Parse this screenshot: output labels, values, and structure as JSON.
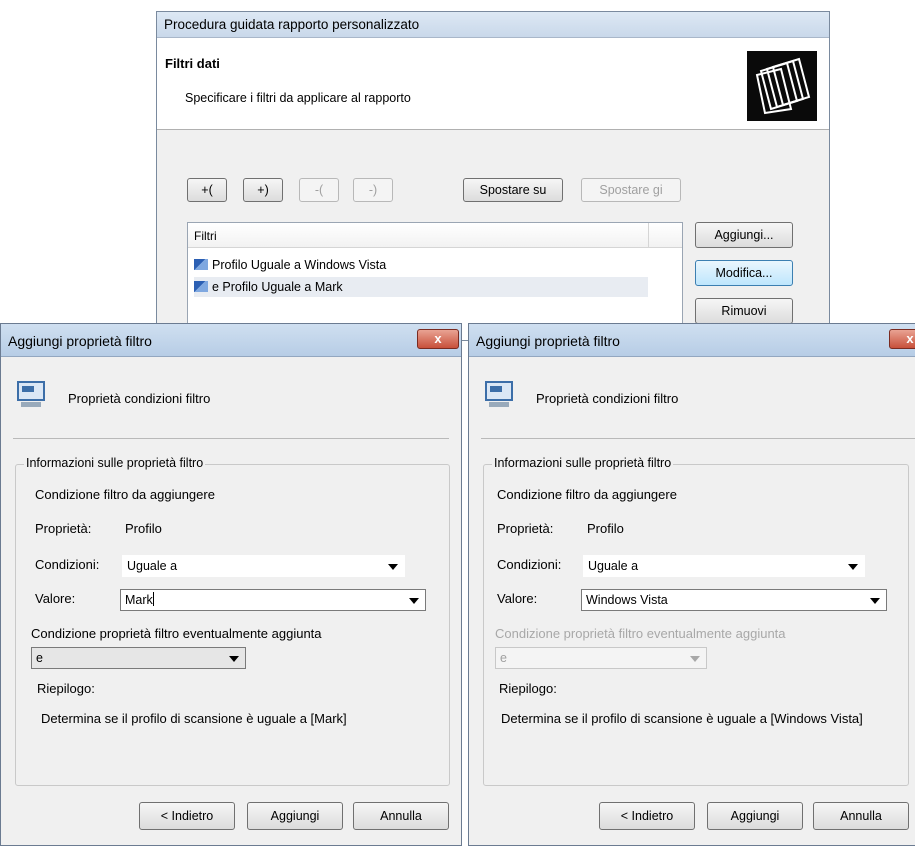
{
  "wizard": {
    "title": "Procedura guidata rapporto personalizzato",
    "header_title": "Filtri dati",
    "header_subtitle": "Specificare i filtri da applicare al rapporto",
    "paren_buttons": [
      "+(",
      "+)",
      "-(",
      "-)"
    ],
    "move_up": "Spostare su",
    "move_down": "Spostare gi",
    "list_header": "Filtri",
    "filters": [
      "Profilo Uguale a Windows Vista",
      "e Profilo Uguale a Mark"
    ],
    "add": "Aggiungi...",
    "edit": "Modifica...",
    "remove": "Rimuovi"
  },
  "dialogs": [
    {
      "title": "Aggiungi proprietà filtro",
      "close": "x",
      "subtitle": "Proprietà condizioni filtro",
      "group_label": "Informazioni sulle proprietà filtro",
      "condition_heading": "Condizione filtro da aggiungere",
      "property_label": "Proprietà:",
      "property_value": "Profilo",
      "conditions_label": "Condizioni:",
      "conditions_value": "Uguale a",
      "value_label": "Valore:",
      "value_value": "Mark",
      "extra_label": "Condizione proprietà filtro eventualmente aggiunta",
      "extra_value": "e",
      "extra_enabled": true,
      "summary_label": "Riepilogo:",
      "summary_text": "Determina se il profilo di scansione è uguale a [Mark]",
      "back": "< Indietro",
      "add": "Aggiungi",
      "cancel": "Annulla"
    },
    {
      "title": "Aggiungi proprietà filtro",
      "close": "x",
      "subtitle": "Proprietà condizioni filtro",
      "group_label": "Informazioni sulle proprietà filtro",
      "condition_heading": "Condizione filtro da aggiungere",
      "property_label": "Proprietà:",
      "property_value": "Profilo",
      "conditions_label": "Condizioni:",
      "conditions_value": "Uguale a",
      "value_label": "Valore:",
      "value_value": "Windows Vista",
      "extra_label": "Condizione proprietà filtro eventualmente aggiunta",
      "extra_value": "e",
      "extra_enabled": false,
      "summary_label": "Riepilogo:",
      "summary_text": "Determina se il profilo di scansione è uguale a [Windows Vista]",
      "back": "< Indietro",
      "add": "Aggiungi",
      "cancel": "Annulla"
    }
  ]
}
